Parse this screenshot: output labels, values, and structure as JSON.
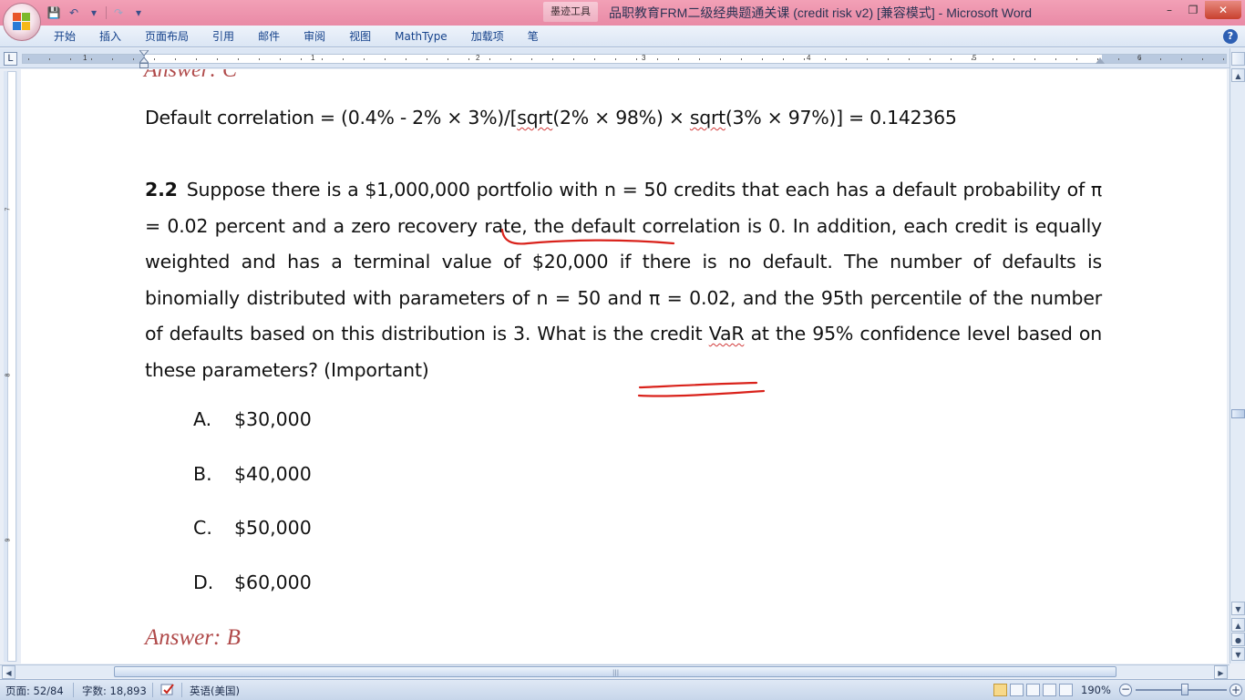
{
  "window": {
    "title": "品职教育FRM二级经典题通关课 (credit risk v2) [兼容模式] - Microsoft Word",
    "context_tool": "墨迹工具",
    "controls": {
      "minimize": "–",
      "restore": "❐",
      "close": "✕"
    }
  },
  "quick_access": {
    "save": "💾",
    "undo": "↶",
    "redo": "↷",
    "customize": "▾"
  },
  "ribbon": {
    "tabs": [
      "开始",
      "插入",
      "页面布局",
      "引用",
      "邮件",
      "审阅",
      "视图",
      "MathType",
      "加载项",
      "笔"
    ],
    "help": "?"
  },
  "ruler": {
    "corner": "L",
    "numbers": [
      "1",
      "1",
      "2",
      "3",
      "4",
      "5",
      "6"
    ],
    "vertical_numbers": [
      "7",
      "8",
      "9"
    ]
  },
  "document": {
    "cut_heading": "Answer: C",
    "correlation_line": {
      "before": "Default correlation = (0.4% - 2% × 3%)/[",
      "sqrt1": "sqrt",
      "middle": "(2% × 98%) × ",
      "sqrt2": "sqrt",
      "after": "(3% × 97%)] = 0.142365"
    },
    "question": {
      "number": "2.2",
      "text_part1": "Suppose there is a $1,000,000 portfolio with n = 50 credits that each has a default probability of π = 0.02 percent and a zero recovery rate, the default correlation is 0. In addition, each credit is equally weighted and has a terminal value of $20,000 if there is no default. The number of defaults is binomially distributed with parameters of n = 50 and π = 0.02, and the 95th percentile of the number of defaults based on this distribution is 3. What is the credit ",
      "var_word": "VaR",
      "text_part2": " at the 95% confidence level based on these parameters? (Important)"
    },
    "options": [
      {
        "letter": "A.",
        "value": "$30,000"
      },
      {
        "letter": "B.",
        "value": "$40,000"
      },
      {
        "letter": "C.",
        "value": "$50,000"
      },
      {
        "letter": "D.",
        "value": "$60,000"
      }
    ],
    "answer": "Answer: B",
    "ink_color": "#d9221b"
  },
  "scrollbars": {
    "up": "▲",
    "down": "▼",
    "left": "◀",
    "right": "▶",
    "prev_page": "▲",
    "browse": "●",
    "next_page": "▼",
    "grip": "|||"
  },
  "status": {
    "page": "页面: 52/84",
    "words": "字数: 18,893",
    "language": "英语(美国)",
    "zoom": "190%",
    "zoom_out": "−",
    "zoom_in": "+"
  }
}
